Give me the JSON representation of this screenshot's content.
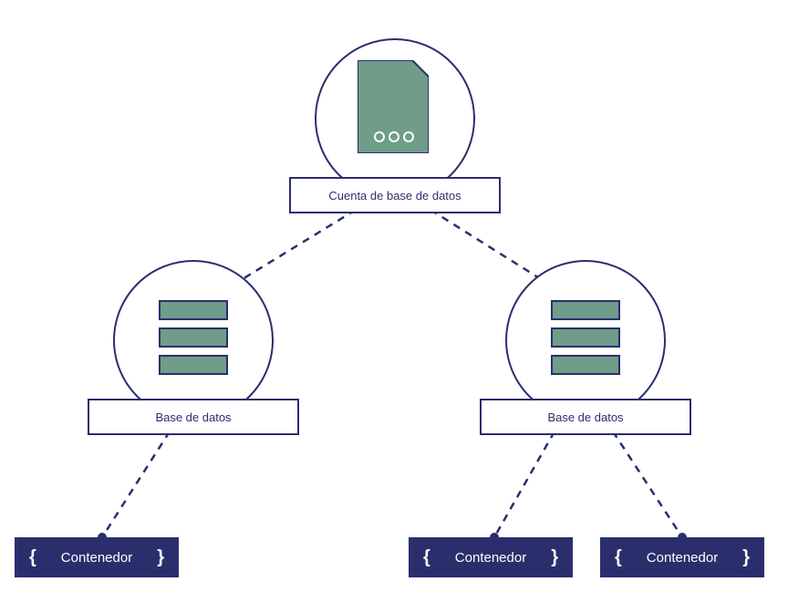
{
  "diagram": {
    "account": {
      "label": "Cuenta de base de datos",
      "icon": "document-dots-icon"
    },
    "databases": [
      {
        "label": "Base de datos",
        "icon": "database-stack-icon"
      },
      {
        "label": "Base de datos",
        "icon": "database-stack-icon"
      }
    ],
    "containers": [
      {
        "label": "Contenedor",
        "brace_left": "{",
        "brace_right": "}"
      },
      {
        "label": "Contenedor",
        "brace_left": "{",
        "brace_right": "}"
      },
      {
        "label": "Contenedor",
        "brace_left": "{",
        "brace_right": "}"
      }
    ],
    "colors": {
      "primary": "#2b2e6d",
      "icon_fill": "#6f9d89",
      "container_bg": "#2b2e6d",
      "container_text": "#ffffff"
    }
  }
}
